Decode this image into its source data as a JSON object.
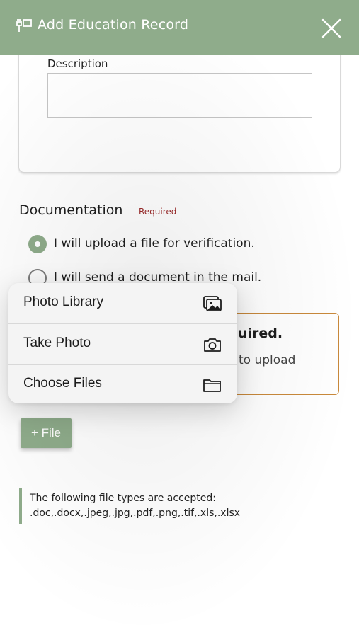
{
  "header": {
    "title": "Add Education Record",
    "icon": "education-icon",
    "close_icon": "close-icon"
  },
  "description": {
    "label": "Description",
    "value": ""
  },
  "documentation": {
    "title": "Documentation",
    "required": "Required",
    "options": [
      {
        "label": "I will upload a file for verification.",
        "selected": true
      },
      {
        "label": "I will send a document in the mail.",
        "selected": false
      }
    ]
  },
  "notice": {
    "title_fragment": "uired.",
    "text_fragment": "to upload"
  },
  "menu": {
    "items": [
      {
        "label": "Photo Library",
        "icon": "photo-library-icon"
      },
      {
        "label": "Take Photo",
        "icon": "camera-icon"
      },
      {
        "label": "Choose Files",
        "icon": "folder-icon"
      }
    ]
  },
  "file_button": {
    "label": "+ File"
  },
  "file_types": {
    "line1": "The following file types are accepted:",
    "line2": ".doc,.docx,.jpeg,.jpg,.pdf,.png,.tif,.xls,.xlsx"
  },
  "colors": {
    "accent": "#8fac8b",
    "required": "#9b2a2a",
    "notice_border": "#c9893b"
  }
}
